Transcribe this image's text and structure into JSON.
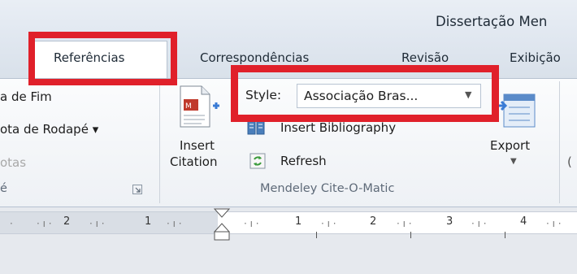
{
  "window": {
    "title": "Dissertação Men"
  },
  "tabs": {
    "referencias": "Referências",
    "correspondencias": "Correspondências",
    "revisao": "Revisão",
    "exibicao": "Exibição"
  },
  "footnotes_group": {
    "insert_endnote": "a de Fim",
    "next_footnote": "ota de Rodapé ▾",
    "show_notes": "otas",
    "group_label": "é",
    "launcher_icon": "dialog-launcher-icon"
  },
  "mendeley": {
    "insert_citation_line1": "Insert",
    "insert_citation_line2": "Citation",
    "style_label": "Style:",
    "style_value": "Associação Bras...",
    "insert_bibliography": "Insert Bibliography",
    "refresh": "Refresh",
    "export_label": "Export",
    "group_label": "Mendeley Cite-O-Matic"
  },
  "ruler": {
    "numbers_left": [
      "2",
      "1"
    ],
    "numbers_right": [
      "1",
      "2",
      "3",
      "4"
    ]
  },
  "annotation_color": "#e0202a"
}
